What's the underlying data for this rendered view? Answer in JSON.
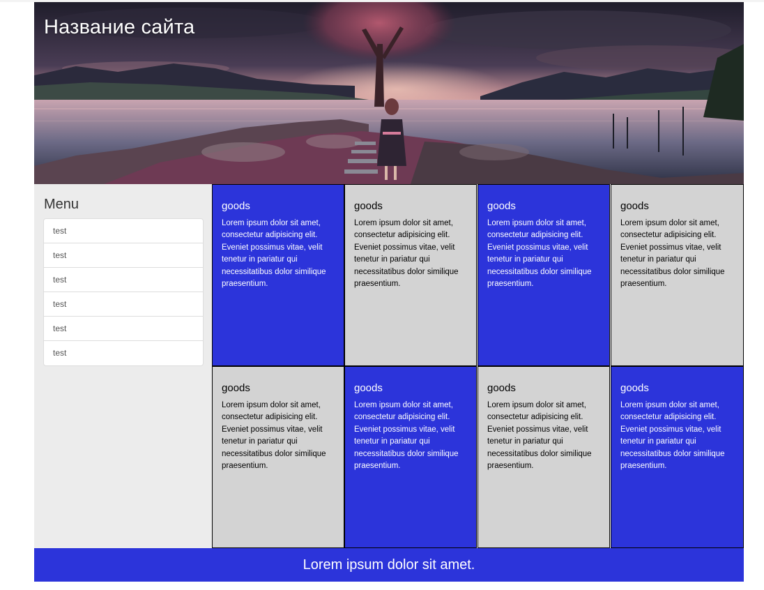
{
  "header": {
    "site_title": "Название сайта"
  },
  "sidebar": {
    "menu_title": "Menu",
    "items": [
      {
        "label": "test"
      },
      {
        "label": "test"
      },
      {
        "label": "test"
      },
      {
        "label": "test"
      },
      {
        "label": "test"
      },
      {
        "label": "test"
      }
    ]
  },
  "cards": [
    {
      "title": "goods",
      "text": "Lorem ipsum dolor sit amet, consectetur adipisicing elit. Eveniet possimus vitae, velit tenetur in pariatur qui necessitatibus dolor similique praesentium.",
      "style": "blue"
    },
    {
      "title": "goods",
      "text": "Lorem ipsum dolor sit amet, consectetur adipisicing elit. Eveniet possimus vitae, velit tenetur in pariatur qui necessitatibus dolor similique praesentium.",
      "style": "grey"
    },
    {
      "title": "goods",
      "text": "Lorem ipsum dolor sit amet, consectetur adipisicing elit. Eveniet possimus vitae, velit tenetur in pariatur qui necessitatibus dolor similique praesentium.",
      "style": "blue"
    },
    {
      "title": "goods",
      "text": "Lorem ipsum dolor sit amet, consectetur adipisicing elit. Eveniet possimus vitae, velit tenetur in pariatur qui necessitatibus dolor similique praesentium.",
      "style": "grey"
    },
    {
      "title": "goods",
      "text": "Lorem ipsum dolor sit amet, consectetur adipisicing elit. Eveniet possimus vitae, velit tenetur in pariatur qui necessitatibus dolor similique praesentium.",
      "style": "grey"
    },
    {
      "title": "goods",
      "text": "Lorem ipsum dolor sit amet, consectetur adipisicing elit. Eveniet possimus vitae, velit tenetur in pariatur qui necessitatibus dolor similique praesentium.",
      "style": "blue"
    },
    {
      "title": "goods",
      "text": "Lorem ipsum dolor sit amet, consectetur adipisicing elit. Eveniet possimus vitae, velit tenetur in pariatur qui necessitatibus dolor similique praesentium.",
      "style": "grey"
    },
    {
      "title": "goods",
      "text": "Lorem ipsum dolor sit amet, consectetur adipisicing elit. Eveniet possimus vitae, velit tenetur in pariatur qui necessitatibus dolor similique praesentium.",
      "style": "blue"
    }
  ],
  "footer": {
    "text": "Lorem ipsum dolor sit amet."
  },
  "colors": {
    "blue": "#2c34da",
    "grey": "#d3d3d3",
    "sidebar_bg": "#ececec"
  }
}
